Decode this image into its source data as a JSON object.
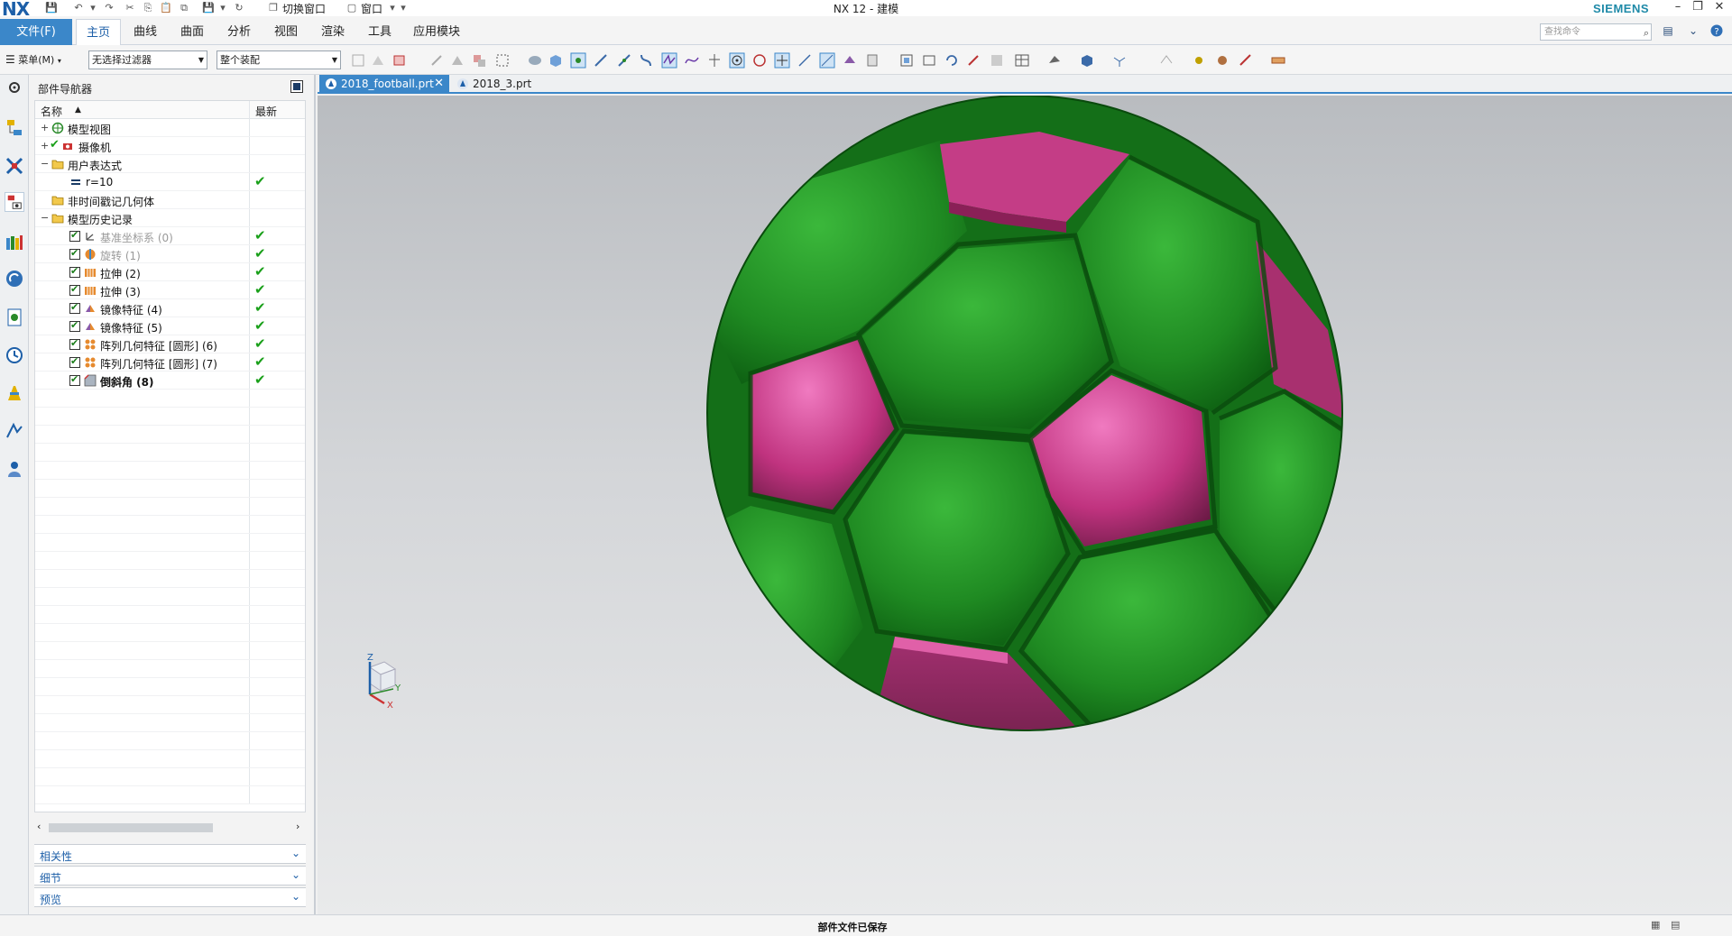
{
  "titlebar": {
    "logo": "NX",
    "title": "NX 12 - 建模",
    "brand": "SIEMENS",
    "switch_window": "切换窗口",
    "window_menu": "窗口",
    "minimize": "–",
    "restore": "❐",
    "close": "✕"
  },
  "ribbon": {
    "file_tab": "文件(F)",
    "tabs": [
      "主页",
      "曲线",
      "曲面",
      "分析",
      "视图",
      "渲染",
      "工具",
      "应用模块"
    ],
    "search_placeholder": "查找命令"
  },
  "toolbar": {
    "menu_label": "菜单(M)",
    "filter_select": "无选择过滤器",
    "assembly_select": "整个装配"
  },
  "navigator": {
    "title": "部件导航器",
    "col_name": "名称",
    "col_latest": "最新",
    "rows": [
      {
        "label": "模型视图",
        "latest": ""
      },
      {
        "label": "摄像机",
        "latest": ""
      },
      {
        "label": "用户表达式",
        "latest": ""
      },
      {
        "label": "r=10",
        "latest": "✔"
      },
      {
        "label": "非时间戳记几何体",
        "latest": ""
      },
      {
        "label": "模型历史记录",
        "latest": ""
      },
      {
        "label": "基准坐标系 (0)",
        "latest": "✔"
      },
      {
        "label": "旋转 (1)",
        "latest": "✔"
      },
      {
        "label": "拉伸 (2)",
        "latest": "✔"
      },
      {
        "label": "拉伸 (3)",
        "latest": "✔"
      },
      {
        "label": "镜像特征 (4)",
        "latest": "✔"
      },
      {
        "label": "镜像特征 (5)",
        "latest": "✔"
      },
      {
        "label": "阵列几何特征 [圆形] (6)",
        "latest": "✔"
      },
      {
        "label": "阵列几何特征 [圆形] (7)",
        "latest": "✔"
      },
      {
        "label": "倒斜角 (8)",
        "latest": "✔"
      }
    ],
    "sections": [
      "相关性",
      "细节",
      "预览"
    ]
  },
  "documents": {
    "tabs": [
      "2018_football.prt",
      "2018_3.prt"
    ]
  },
  "viewport": {
    "axis_z": "Z",
    "axis_x": "X",
    "axis_y": "Y",
    "colors": {
      "green": "#1f8a22",
      "pink": "#c0337f",
      "background_top": "#b9bcc0",
      "background_bottom": "#e9eaeb"
    }
  },
  "status": {
    "message": "部件文件已保存"
  }
}
